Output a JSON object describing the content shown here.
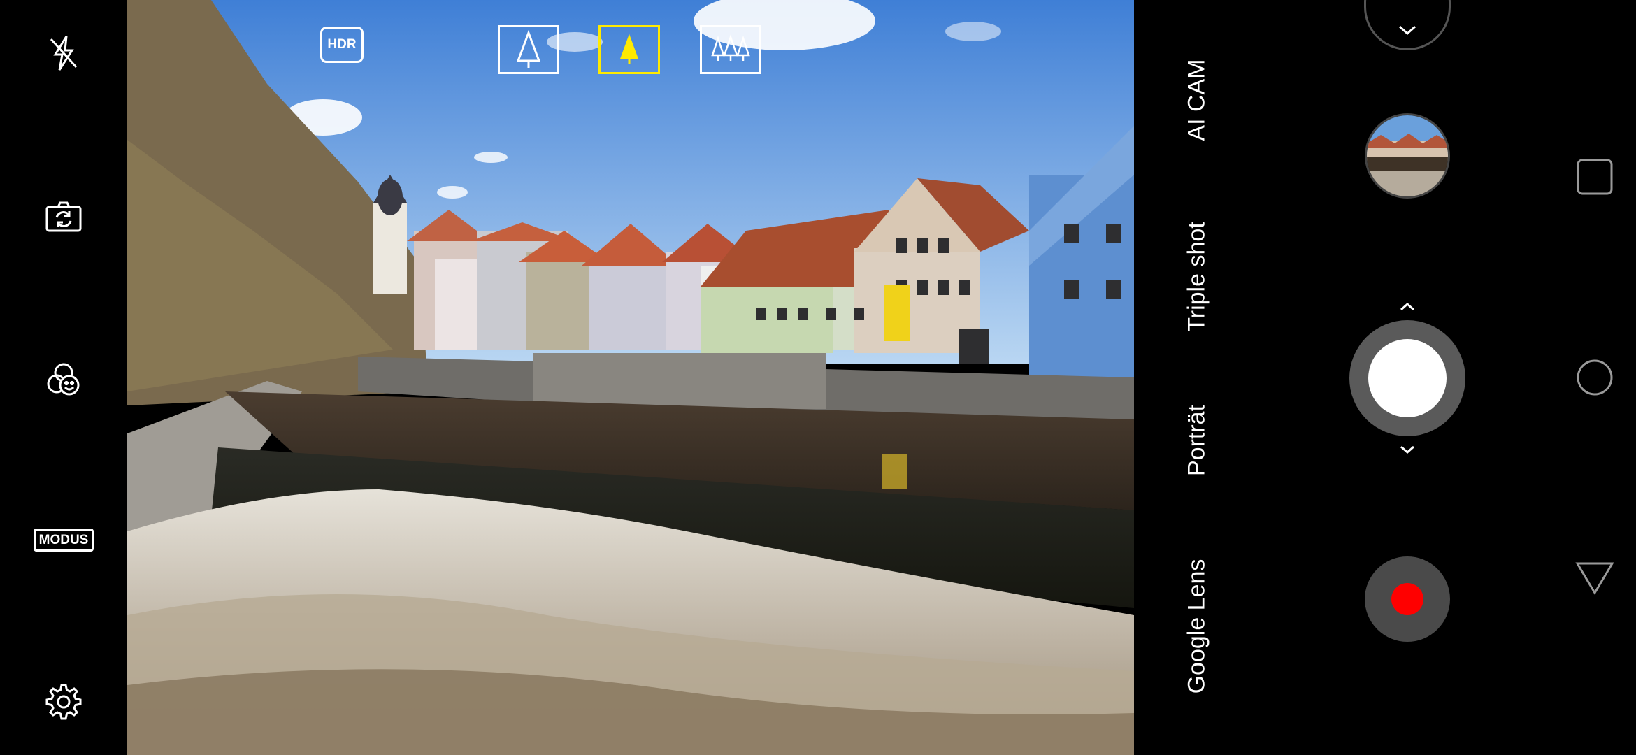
{
  "top_controls": {
    "hdr_label": "HDR"
  },
  "left_toolbar": {
    "modus_label": "MODUS"
  },
  "modes": [
    {
      "label": "AI CAM"
    },
    {
      "label": "Triple shot"
    },
    {
      "label": "Porträt"
    },
    {
      "label": "Google Lens"
    }
  ],
  "colors": {
    "selected_lens": "#ffea00",
    "record": "#ff0000",
    "shutter_ring": "#5a5a5a"
  },
  "icons": {
    "flash": "flash-off-icon",
    "switch_camera": "switch-camera-icon",
    "filters": "filter-smile-icon",
    "settings": "gear-icon",
    "lens_wide": "tree-single-outline-icon",
    "lens_normal": "tree-single-filled-icon",
    "lens_ultrawide": "tree-triple-outline-icon",
    "nav_recents": "square-icon",
    "nav_home": "circle-icon",
    "nav_back": "triangle-back-icon"
  }
}
